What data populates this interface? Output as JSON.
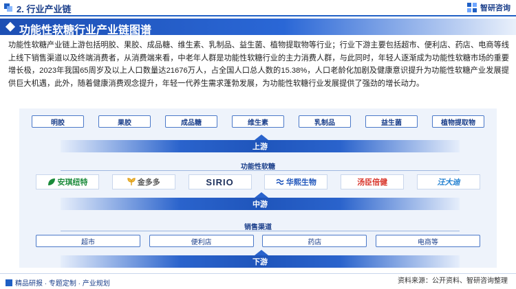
{
  "header": {
    "section_title": "2. 行业产业链",
    "brand_name": "智研咨询"
  },
  "title": "功能性软糖行业产业链图谱",
  "paragraph": "功能性软糖产业链上游包括明胶、果胶、成品糖、维生素、乳制品、益生菌、植物提取物等行业；行业下游主要包括超市、便利店、药店、电商等线上线下销售渠道以及终端消费者，从消费端来看，中老年人群是功能性软糖行业的主力消费人群，与此同时，年轻人逐渐成为功能性软糖市场的重要增长极，2023年我国65周岁及以上人口数量达21676万人，占全国人口总人数的15.38%，人口老龄化加剧及健康意识提升为功能性软糖产业发展提供巨大机遇，此外，随着健康消费观念提升，年轻一代养生需求蓬勃发展，为功能性软糖行业发展提供了强劲的增长动力。",
  "upstream": {
    "items": [
      "明胶",
      "果胶",
      "成品糖",
      "维生素",
      "乳制品",
      "益生菌",
      "植物提取物"
    ],
    "label": "上游"
  },
  "midstream": {
    "category": "功能性软糖",
    "logos": [
      {
        "text": "安琪纽特",
        "color": "#1a8a3a",
        "icon": "leaf-icon"
      },
      {
        "text": "金多多",
        "color": "#555555",
        "icon": "sprout-icon"
      },
      {
        "text": "SIRIO",
        "color": "#1a2e5a",
        "icon": "wordmark"
      },
      {
        "text": "华熙生物",
        "color": "#1f55bb",
        "icon": "wave-icon"
      },
      {
        "text": "汤臣倍健",
        "color": "#d8342a",
        "icon": "wordmark"
      },
      {
        "text": "汪大迪",
        "color": "#1f7fd0",
        "icon": "wordmark"
      }
    ],
    "label": "中游"
  },
  "downstream": {
    "category": "销售渠道",
    "items": [
      "超市",
      "便利店",
      "药店",
      "电商等"
    ],
    "label": "下游"
  },
  "footer": {
    "left": "精品研报 · 专题定制 · 产业规划",
    "source": "资料来源：公开资料、智研咨询整理"
  }
}
